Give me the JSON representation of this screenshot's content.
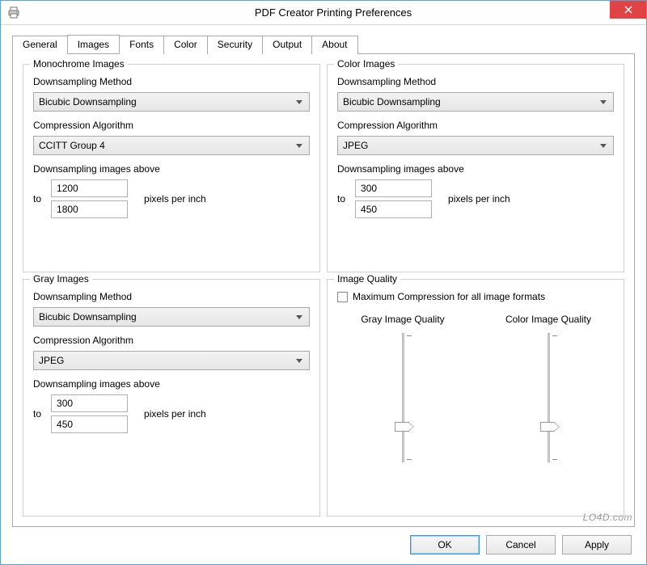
{
  "window": {
    "title": "PDF Creator Printing Preferences"
  },
  "tabs": {
    "general": "General",
    "images": "Images",
    "fonts": "Fonts",
    "color": "Color",
    "security": "Security",
    "output": "Output",
    "about": "About"
  },
  "labels": {
    "downsampling_method": "Downsampling Method",
    "compression_algorithm": "Compression Algorithm",
    "downsampling_above": "Downsampling images above",
    "to": "to",
    "ppi": "pixels per inch",
    "max_compression": "Maximum Compression for all image formats",
    "gray_quality": "Gray Image Quality",
    "color_quality": "Color Image Quality"
  },
  "groups": {
    "mono": {
      "title": "Monochrome Images",
      "method": "Bicubic Downsampling",
      "algorithm": "CCITT Group 4",
      "above1": "1200",
      "above2": "1800"
    },
    "color": {
      "title": "Color Images",
      "method": "Bicubic Downsampling",
      "algorithm": "JPEG",
      "above1": "300",
      "above2": "450"
    },
    "gray": {
      "title": "Gray Images",
      "method": "Bicubic Downsampling",
      "algorithm": "JPEG",
      "above1": "300",
      "above2": "450"
    },
    "quality": {
      "title": "Image Quality"
    }
  },
  "buttons": {
    "ok": "OK",
    "cancel": "Cancel",
    "apply": "Apply"
  },
  "watermark": "LO4D.com"
}
